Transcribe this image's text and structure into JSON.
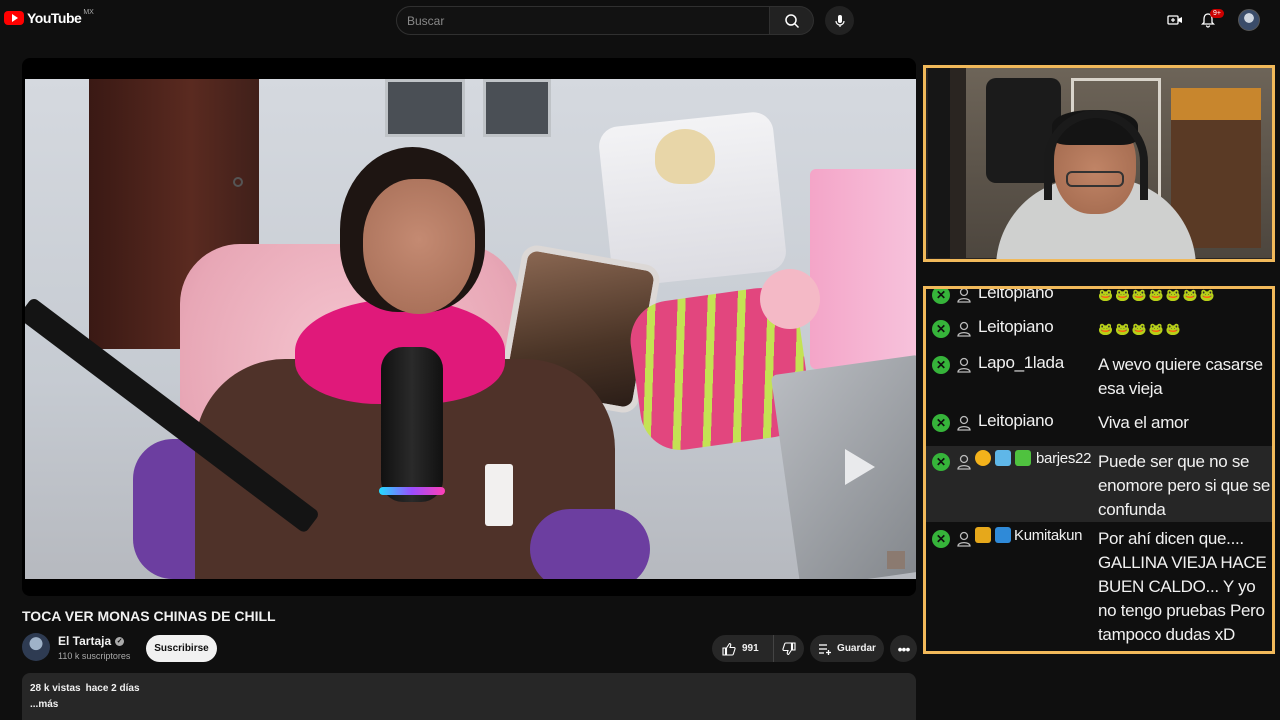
{
  "header": {
    "logo_text": "YouTube",
    "region": "MX",
    "search_placeholder": "Buscar",
    "notification_count": "9+"
  },
  "video": {
    "title": "TOCA VER MONAS CHINAS DE CHILL",
    "channel": {
      "name": "El Tartaja",
      "subscribers": "110 k suscriptores",
      "subscribe_label": "Suscribirse"
    },
    "likes": "991",
    "save_label": "Guardar",
    "views": "28 k vistas",
    "date": "hace 2 días",
    "more_label": "...más"
  },
  "chat": {
    "messages": [
      {
        "author": "Leitopiano",
        "text": "",
        "emotes": "🐸🐸🐸🐸🐸🐸🐸",
        "highlight": false
      },
      {
        "author": "Leitopiano",
        "text": "",
        "emotes": "🐸🐸🐸🐸🐸",
        "highlight": false
      },
      {
        "author": "Lapo_1lada",
        "text": "A wevo quiere casarse esa vieja",
        "highlight": false
      },
      {
        "author": "Leitopiano",
        "text": "Viva el amor",
        "highlight": false
      },
      {
        "author": "barjes22",
        "text": "Puede ser que no se enomore pero si que se confunda",
        "highlight": true
      },
      {
        "author": "Kumitakun",
        "text": "Por ahí dicen que.... GALLINA VIEJA HACE BUEN CALDO... Y yo no tengo pruebas Pero tampoco dudas xD",
        "highlight": false
      }
    ]
  },
  "colors": {
    "accent": "#ff0000",
    "frame_border": "#f1b95a",
    "mod_badge": "#36b43a"
  }
}
